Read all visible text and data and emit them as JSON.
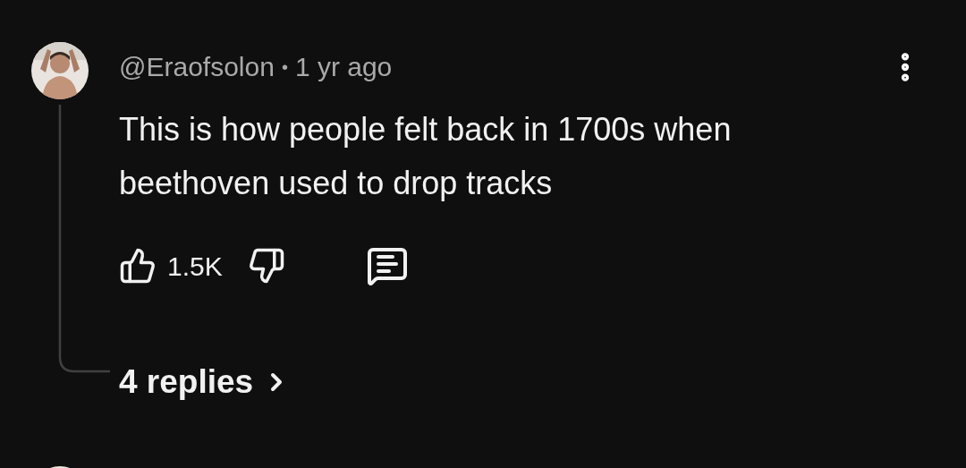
{
  "comment": {
    "author": "@Eraofsolon",
    "separator": "•",
    "time": "1 yr ago",
    "text": "This is how people felt back in 1700s when beethoven used to drop tracks",
    "likes": "1.5K"
  },
  "replies_link": {
    "label": "4 replies"
  }
}
